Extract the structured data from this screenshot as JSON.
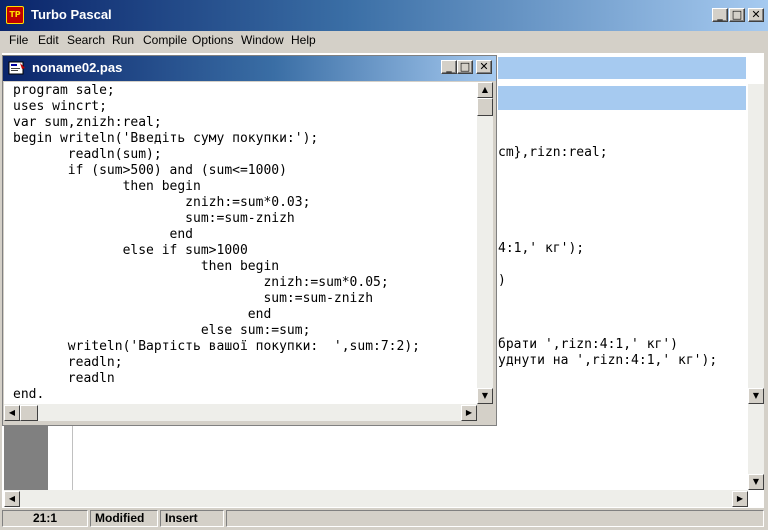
{
  "app": {
    "title": "Turbo Pascal",
    "icon_label": "TP",
    "icon": "turbo-pascal-icon"
  },
  "window_controls": {
    "minimize": "_",
    "maximize": "□",
    "close": "✕"
  },
  "menu": [
    "File",
    "Edit",
    "Search",
    "Run",
    "Compile",
    "Options",
    "Window",
    "Help"
  ],
  "background_editor": {
    "visible_fragments": [
      "cm},rizn:real;",
      "4:1,' кг');",
      ")",
      "брати ',rizn:4:1,' кг')",
      "уднути на ',rizn:4:1,' кг');"
    ]
  },
  "editor": {
    "title": "noname02.pas",
    "icon": "pascal-file-icon",
    "lines": [
      "program sale;",
      "uses wincrt;",
      "var sum,znizh:real;",
      "begin writeln('Введіть суму покупки:');",
      "       readln(sum);",
      "       if (sum>500) and (sum<=1000)",
      "              then begin",
      "                      znizh:=sum*0.03;",
      "                      sum:=sum-znizh",
      "                    end",
      "              else if sum>1000",
      "                        then begin",
      "                                znizh:=sum*0.05;",
      "                                sum:=sum-znizh",
      "                              end",
      "                        else sum:=sum;",
      "       writeln('Вартість вашої покупки:  ',sum:7:2);",
      "       readln;",
      "       readln",
      "end."
    ]
  },
  "status": {
    "position": "21:1",
    "modified": "Modified",
    "mode": "Insert"
  },
  "colors": {
    "title_active": "#0a246a",
    "title_gradient_end": "#a6caf0",
    "face": "#d4d0c8"
  }
}
